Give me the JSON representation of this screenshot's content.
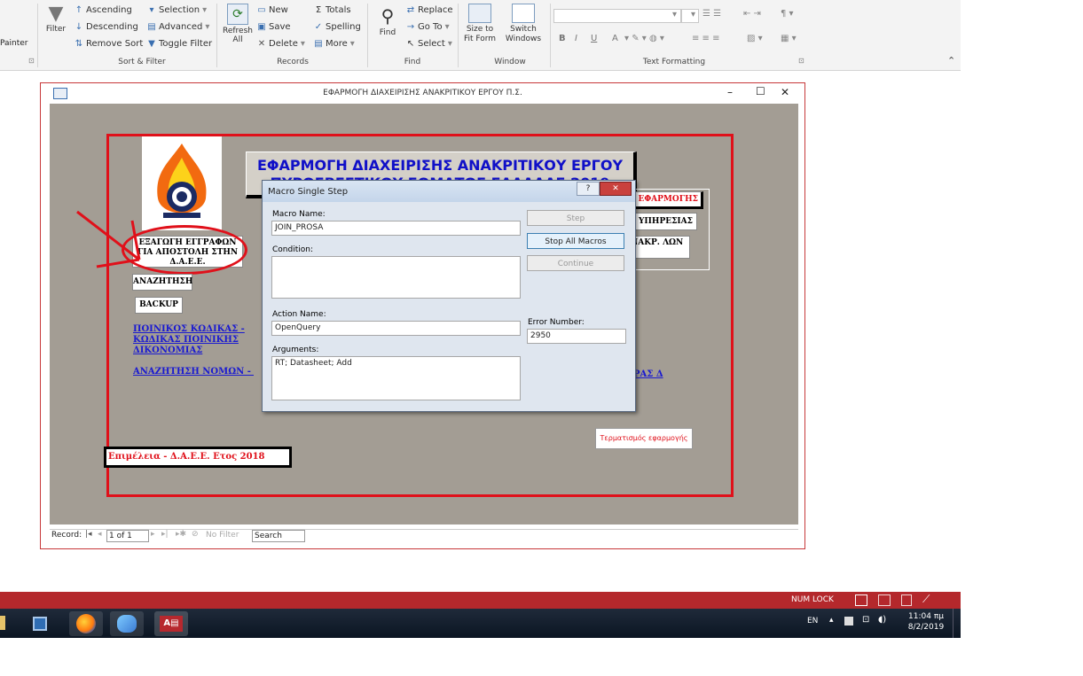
{
  "ribbon": {
    "painter_label": "Painter",
    "sort_filter": {
      "filter": "Filter",
      "ascending": "Ascending",
      "descending": "Descending",
      "remove_sort": "Remove Sort",
      "selection": "Selection",
      "advanced": "Advanced",
      "toggle_filter": "Toggle Filter",
      "group_label": "Sort & Filter"
    },
    "records": {
      "refresh_all": "Refresh All",
      "new": "New",
      "save": "Save",
      "delete": "Delete",
      "totals": "Totals",
      "spelling": "Spelling",
      "more": "More",
      "group_label": "Records"
    },
    "find": {
      "find": "Find",
      "replace": "Replace",
      "go_to": "Go To",
      "select": "Select",
      "group_label": "Find"
    },
    "window": {
      "size_to_fit": "Size to Fit Form",
      "switch_windows": "Switch Windows",
      "group_label": "Window"
    },
    "text_formatting": {
      "bold": "B",
      "italic": "I",
      "underline": "U",
      "font_color": "A",
      "group_label": "Text Formatting"
    }
  },
  "form_window": {
    "title": "ΕΦΑΡΜΟΓΗ ΔΙΑΧΕΙΡΙΣΗΣ ΑΝΑΚΡΙΤΙΚΟΥ ΕΡΓΟΥ Π.Σ.",
    "minimize": "–",
    "maximize": "☐",
    "close": "✕"
  },
  "form": {
    "header_line1": "ΕΦΑΡΜΟΓΗ ΔΙΑΧΕΙΡΙΣΗΣ ΑΝΑΚΡΙΤΙΚΟΥ ΕΡΓΟΥ",
    "header_line2": "ΠΥΡΟΣΒΕΣΤΙΚΟΥ ΣΩΜΑΤΟΣ ΕΛΛΑΔΑΣ 2019",
    "export_button": "ΕΞΑΓΩΓΗ ΕΓΓΡΑΦΩΝ ΓΙΑ ΑΠΟΣΤΟΛΗ ΣΤΗΝ Δ.Α.Ε.Ε.",
    "search_button": "ΑΝΑΖΗΤΗΣΗ",
    "backup_button": "BACKUP",
    "link_penal_codes": "ΠΟΙΝΙΚΟΣ ΚΩΔΙΚΑΣ - ΚΩΔΙΚΑΣ ΠΟΙΝΙΚΗΣ ΔΙΚΟΝΟΜΙΑΣ",
    "link_law_search": "ΑΝΑΖΗΤΗΣΗ ΝΟΜΩΝ - ΠΔ",
    "right_btn_app": "Η ΕΦΑΡΜΟΓΗΣ",
    "right_btn_service": "Υ ΥΠΗΡΕΣΙΑΣ",
    "right_btn_inv": "ΝΑΚΡ. ΛΩΝ",
    "right_link": "ΡΑΣ Δ",
    "exit_button": "Τερματισμός εφαρμογής",
    "footer": "Επιμέλεια - Δ.Α.Ε.Ε. Ετος 2018"
  },
  "record_nav": {
    "label": "Record:",
    "position": "1 of 1",
    "no_filter": "No Filter",
    "search": "Search"
  },
  "dialog": {
    "title": "Macro Single Step",
    "help": "?",
    "close": "✕",
    "macro_name_label": "Macro Name:",
    "macro_name_value": "JOIN_PROSA",
    "condition_label": "Condition:",
    "condition_value": "",
    "action_name_label": "Action Name:",
    "action_name_value": "OpenQuery",
    "arguments_label": "Arguments:",
    "arguments_value": "RT; Datasheet; Add",
    "error_number_label": "Error Number:",
    "error_number_value": "2950",
    "step_button": "Step",
    "stop_all_button": "Stop All Macros",
    "continue_button": "Continue"
  },
  "status_bar": {
    "num_lock": "NUM LOCK"
  },
  "taskbar": {
    "language": "EN",
    "time": "11:04 πμ",
    "date": "8/2/2019"
  },
  "colors": {
    "status_bar": "#b4282c",
    "form_bg": "#a39d94",
    "frame_red": "#e0101a",
    "title_blue": "#1010c8"
  }
}
